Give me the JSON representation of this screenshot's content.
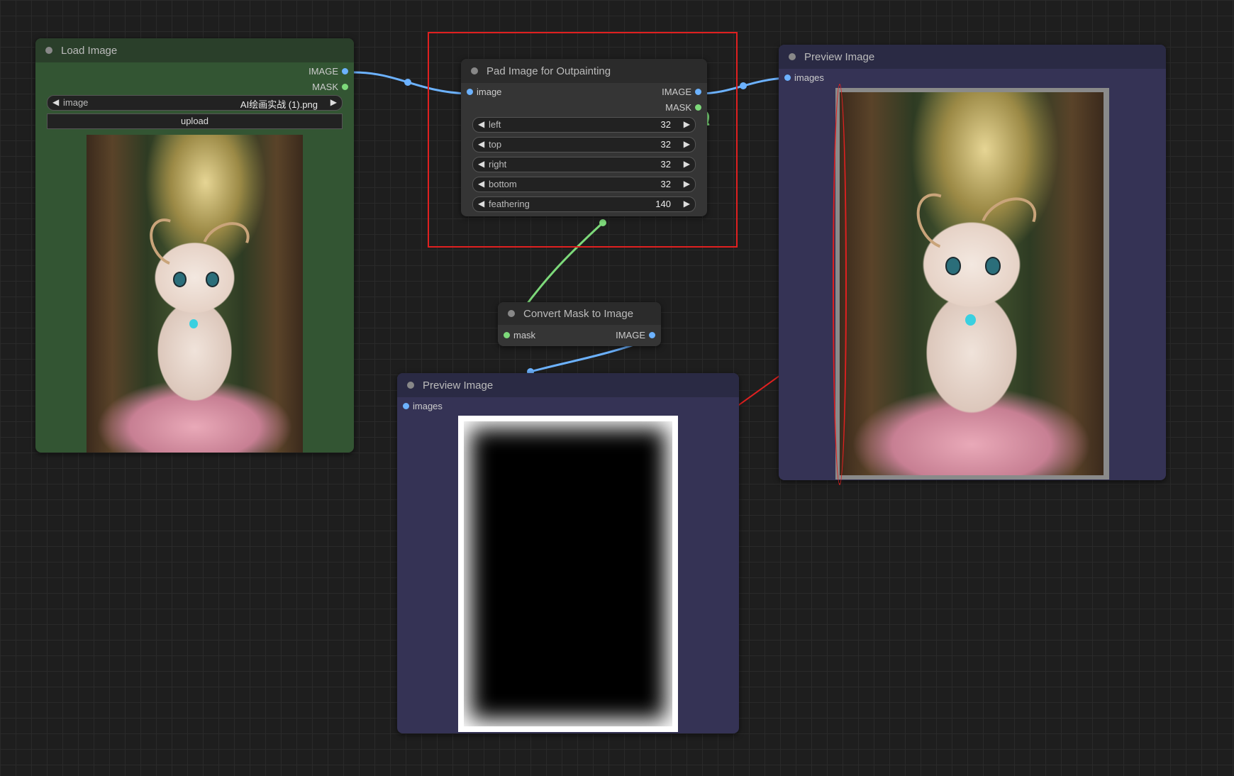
{
  "load_image": {
    "title": "Load Image",
    "outputs": [
      "IMAGE",
      "MASK"
    ],
    "image_widget": {
      "label": "image",
      "value": "AI绘画实战 (1).png"
    },
    "upload_label": "upload"
  },
  "pad_node": {
    "title": "Pad Image for Outpainting",
    "input": "image",
    "outputs": [
      "IMAGE",
      "MASK"
    ],
    "widgets": [
      {
        "label": "left",
        "value": "32"
      },
      {
        "label": "top",
        "value": "32"
      },
      {
        "label": "right",
        "value": "32"
      },
      {
        "label": "bottom",
        "value": "32"
      },
      {
        "label": "feathering",
        "value": "140"
      }
    ]
  },
  "convert_node": {
    "title": "Convert Mask to Image",
    "input": "mask",
    "output": "IMAGE"
  },
  "preview_right": {
    "title": "Preview Image",
    "input": "images"
  },
  "preview_bottom": {
    "title": "Preview Image",
    "input": "images"
  },
  "colors": {
    "canvas_bg": "#1e1e1e",
    "load_node_bg": "#335533",
    "preview_node_bg": "#353355",
    "default_node_bg": "#353535",
    "image_wire": "#6cb2ff",
    "mask_wire": "#7dd97a",
    "annotation": "#e02020"
  }
}
